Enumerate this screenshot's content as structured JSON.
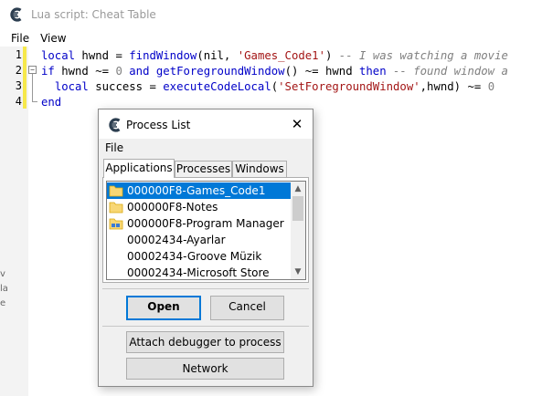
{
  "window": {
    "title": "Lua script: Cheat Table",
    "menu": [
      "File",
      "View"
    ]
  },
  "editor": {
    "line_numbers": [
      "1",
      "2",
      "3",
      "4"
    ],
    "lines": [
      [
        {
          "t": "local",
          "c": "kw"
        },
        {
          "t": " hwnd = ",
          "c": "pl"
        },
        {
          "t": "findWindow",
          "c": "fn"
        },
        {
          "t": "(nil, ",
          "c": "pl"
        },
        {
          "t": "'Games_Code1'",
          "c": "str"
        },
        {
          "t": ") ",
          "c": "pl"
        },
        {
          "t": "-- I was watching a movie",
          "c": "cm"
        }
      ],
      [
        {
          "t": "if",
          "c": "kw"
        },
        {
          "t": " hwnd ~= ",
          "c": "pl"
        },
        {
          "t": "0",
          "c": "num"
        },
        {
          "t": " ",
          "c": "pl"
        },
        {
          "t": "and",
          "c": "kw"
        },
        {
          "t": " ",
          "c": "pl"
        },
        {
          "t": "getForegroundWindow",
          "c": "fn"
        },
        {
          "t": "() ~= hwnd ",
          "c": "pl"
        },
        {
          "t": "then",
          "c": "kw"
        },
        {
          "t": " ",
          "c": "pl"
        },
        {
          "t": "-- found window a",
          "c": "cm"
        }
      ],
      [
        {
          "t": "  ",
          "c": "pl"
        },
        {
          "t": "local",
          "c": "kw"
        },
        {
          "t": " success = ",
          "c": "pl"
        },
        {
          "t": "executeCodeLocal",
          "c": "fn"
        },
        {
          "t": "(",
          "c": "pl"
        },
        {
          "t": "'SetForegroundWindow'",
          "c": "str"
        },
        {
          "t": ",hwnd) ~= ",
          "c": "pl"
        },
        {
          "t": "0",
          "c": "num"
        }
      ],
      [
        {
          "t": "end",
          "c": "kw"
        }
      ]
    ]
  },
  "dialog": {
    "title": "Process List",
    "close_glyph": "✕",
    "menu": [
      "File"
    ],
    "tabs": [
      "Applications",
      "Processes",
      "Windows"
    ],
    "active_tab": "Applications",
    "items": [
      {
        "label": "000000F8-Games_Code1",
        "icon": "folder-icon",
        "selected": true
      },
      {
        "label": "000000F8-Notes",
        "icon": "folder-icon",
        "selected": false
      },
      {
        "label": "000000F8-Program Manager",
        "icon": "program-manager-icon",
        "selected": false
      },
      {
        "label": "00002434-Ayarlar",
        "icon": "",
        "selected": false
      },
      {
        "label": "00002434-Groove Müzik",
        "icon": "",
        "selected": false
      },
      {
        "label": "00002434-Microsoft Store",
        "icon": "",
        "selected": false
      }
    ],
    "buttons": {
      "open": "Open",
      "cancel": "Cancel",
      "attach": "Attach debugger to process",
      "network": "Network"
    }
  },
  "colors": {
    "selection": "#0078d7",
    "keyword": "#0000c8",
    "string": "#a31515",
    "comment": "#808080",
    "change_bar": "#f6e84b"
  }
}
